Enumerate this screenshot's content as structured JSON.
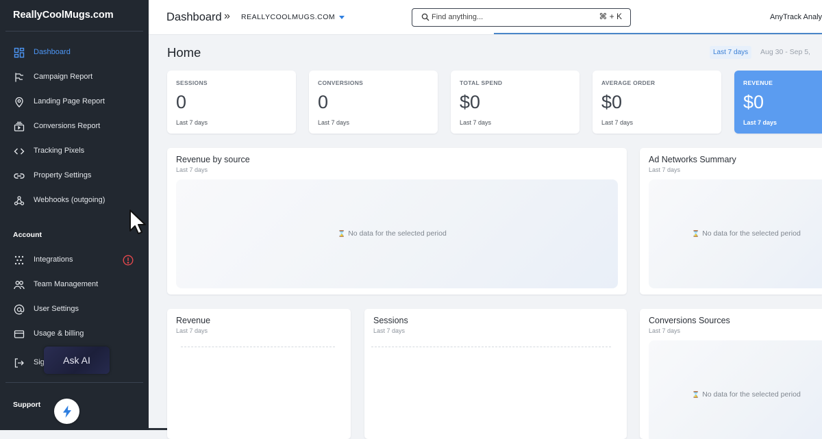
{
  "sidebar": {
    "brand": "ReallyCoolMugs.com",
    "nav": [
      {
        "label": "Dashboard",
        "icon": "dashboard-grid-icon",
        "active": true
      },
      {
        "label": "Campaign Report",
        "icon": "campaign-flow-icon"
      },
      {
        "label": "Landing Page Report",
        "icon": "map-pin-icon"
      },
      {
        "label": "Conversions Report",
        "icon": "conversions-stack-icon"
      },
      {
        "label": "Tracking Pixels",
        "icon": "code-brackets-icon"
      },
      {
        "label": "Property Settings",
        "icon": "link-icon"
      },
      {
        "label": "Webhooks (outgoing)",
        "icon": "webhook-icon"
      }
    ],
    "account_heading": "Account",
    "account_items": [
      {
        "label": "Integrations",
        "icon": "integrations-dots-icon",
        "alert": true
      },
      {
        "label": "Team Management",
        "icon": "team-icon"
      },
      {
        "label": "User Settings",
        "icon": "at-sign-icon"
      },
      {
        "label": "Usage & billing",
        "icon": "credit-card-icon"
      },
      {
        "label": "Sig",
        "icon": "sign-out-icon"
      }
    ],
    "support_heading": "Support",
    "ask_ai_label": "Ask AI",
    "accent_color": "#4d96f5"
  },
  "header": {
    "title": "Dashboard",
    "separator": "»",
    "site": "REALLYCOOLMUGS.COM",
    "search_placeholder": "Find anything...",
    "search_shortcut": "⌘ + K",
    "account": "AnyTrack Analy"
  },
  "page": {
    "title": "Home",
    "date_preset": "Last 7 days",
    "date_range": "Aug 30  -  Sep 5,"
  },
  "kpis": [
    {
      "label": "SESSIONS",
      "value": "0",
      "period": "Last 7 days"
    },
    {
      "label": "CONVERSIONS",
      "value": "0",
      "period": "Last 7 days"
    },
    {
      "label": "TOTAL SPEND",
      "value": "$0",
      "period": "Last 7 days"
    },
    {
      "label": "AVERAGE ORDER",
      "value": "$0",
      "period": "Last 7 days"
    },
    {
      "label": "REVENUE",
      "value": "$0",
      "period": "Last 7 days",
      "highlight": true,
      "color": "#5b9cf0"
    }
  ],
  "panels": {
    "revenue_by_source": {
      "title": "Revenue by source",
      "period": "Last 7 days",
      "empty": "No data for the selected period"
    },
    "ad_networks": {
      "title": "Ad Networks Summary",
      "period": "Last 7 days",
      "empty": "No data for the selected period"
    },
    "revenue": {
      "title": "Revenue",
      "period": "Last 7 days"
    },
    "sessions": {
      "title": "Sessions",
      "period": "Last 7 days"
    },
    "conversion_sources": {
      "title": "Conversions Sources",
      "period": "Last 7 days",
      "empty": "No data for the selected period"
    }
  }
}
